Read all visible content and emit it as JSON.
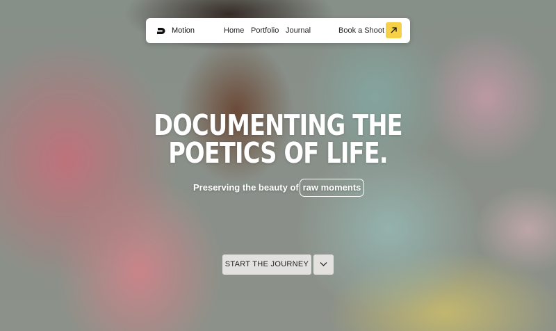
{
  "nav": {
    "brand": "Motion",
    "links": [
      "Home",
      "Portfolio",
      "Journal"
    ],
    "book_label": "Book a Shoot",
    "book_icon": "arrow-up-right-icon",
    "accent": "#f6d046"
  },
  "hero": {
    "headline_line1": "DOCUMENTING THE",
    "headline_line2": "POETICS OF LIFE.",
    "subtext": "Preserving the beauty of",
    "pill_text": "raw moments",
    "cta_label": "START THE JOURNEY",
    "cta_icon": "chevron-down-icon"
  }
}
